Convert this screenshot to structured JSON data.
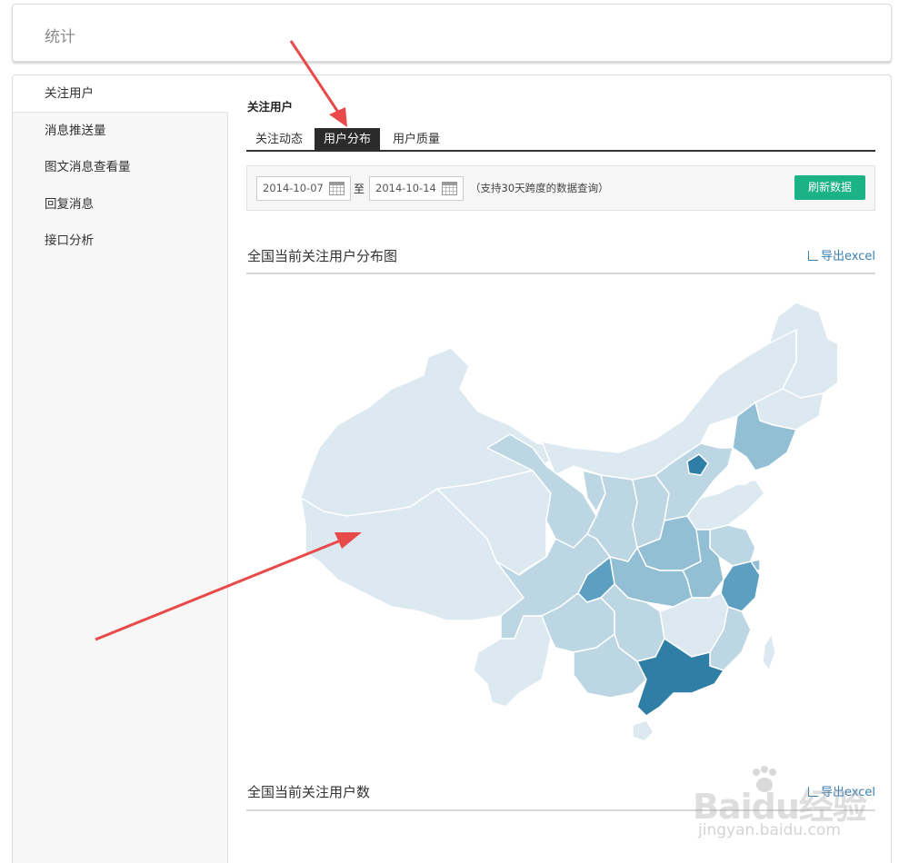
{
  "header": {
    "title": "统计"
  },
  "sidebar": {
    "items": [
      {
        "label": "关注用户",
        "active": true
      },
      {
        "label": "消息推送量"
      },
      {
        "label": "图文消息查看量"
      },
      {
        "label": "回复消息"
      },
      {
        "label": "接口分析"
      }
    ]
  },
  "main": {
    "section_title": "关注用户",
    "tabs": [
      {
        "label": "关注动态"
      },
      {
        "label": "用户分布",
        "active": true
      },
      {
        "label": "用户质量"
      }
    ],
    "filter": {
      "start_date": "2014-10-07",
      "to_label": "至",
      "end_date": "2014-10-14",
      "hint": "（支持30天跨度的数据查询）",
      "refresh_label": "刷新数据"
    },
    "map_block": {
      "title": "全国当前关注用户分布图",
      "export_label": "导出excel"
    },
    "count_block": {
      "title": "全国当前关注用户数",
      "export_label": "导出excel"
    }
  },
  "watermark": {
    "brand": "Baidu经验",
    "url": "jingyan.baidu.com"
  },
  "colors": {
    "accent_button": "#1bb285",
    "link": "#3a7fb3",
    "map_lightest": "#dce9f0",
    "map_light": "#bcd6e3",
    "map_mid": "#93bfd4",
    "map_dark": "#5c9fc0",
    "map_darkest": "#2f7ea6",
    "annotation_arrow": "#e84a4a"
  }
}
